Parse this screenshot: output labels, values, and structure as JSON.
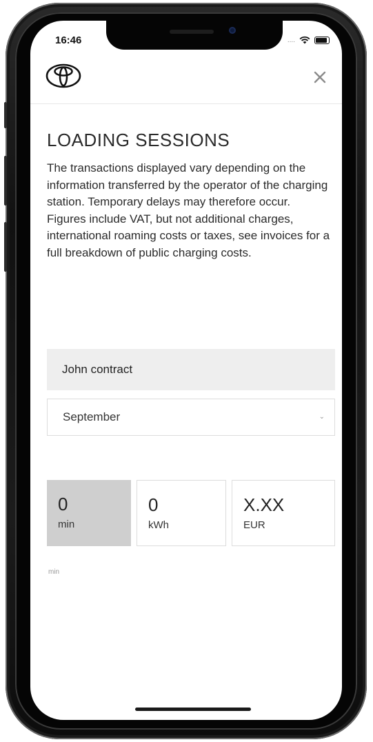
{
  "status_bar": {
    "time": "16:46",
    "signal_dots": "....",
    "wifi_icon": "wifi-icon",
    "battery_icon": "battery-icon"
  },
  "header": {
    "logo_icon": "toyota-logo-icon",
    "close_label": "×"
  },
  "page": {
    "title": "LOADING SESSIONS",
    "description": "The transactions displayed vary depending on the information transferred by the operator of the charging station. Temporary delays may therefore occur. Figures include VAT, but not additional charges, international roaming costs or taxes, see invoices for a full breakdown of public charging costs."
  },
  "contract": {
    "name": "John contract"
  },
  "month_select": {
    "value": "September",
    "chevron_icon": "chevron-down-icon"
  },
  "stats": [
    {
      "value": "0",
      "unit": "min"
    },
    {
      "value": "0",
      "unit": "kWh"
    },
    {
      "value": "X.XX",
      "unit": "EUR"
    }
  ],
  "chart_label": "min",
  "colors": {
    "selected_stat": "#cfcfcf",
    "contract_bg": "#eeeeee",
    "text": "#2a2a2a"
  }
}
